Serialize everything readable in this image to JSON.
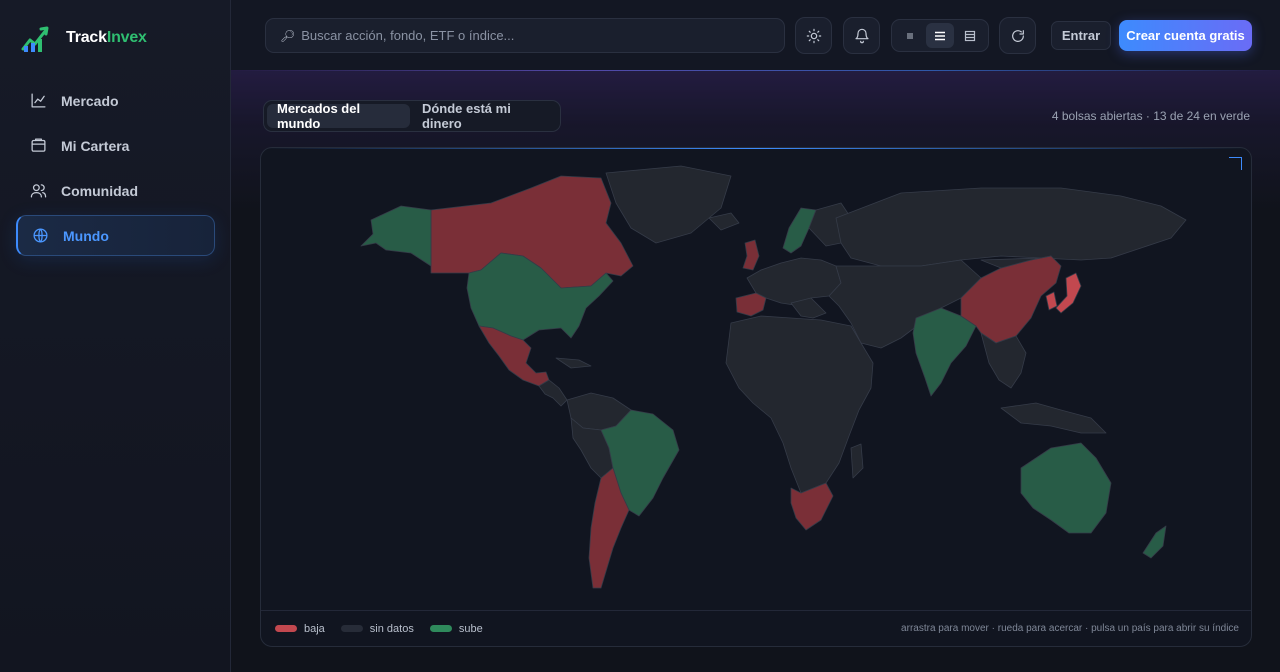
{
  "app": {
    "brand_first": "Track",
    "brand_second": "Invex"
  },
  "sidebar": {
    "items": [
      {
        "label": "Mercado",
        "icon": "chart-line-icon",
        "active": false
      },
      {
        "label": "Mi Cartera",
        "icon": "wallet-icon",
        "active": false
      },
      {
        "label": "Comunidad",
        "icon": "users-icon",
        "active": false
      },
      {
        "label": "Mundo",
        "icon": "globe-icon",
        "active": true
      }
    ]
  },
  "topbar": {
    "search_placeholder": "Buscar acción, fondo, ETF o índice...",
    "login_label": "Entrar",
    "signup_label": "Crear cuenta gratis",
    "density_options": [
      "compact",
      "normal",
      "comfortable"
    ],
    "density_selected": "normal"
  },
  "main": {
    "tabs": [
      {
        "label": "Mercados del mundo",
        "active": true
      },
      {
        "label": "Dónde está mi dinero",
        "active": false
      }
    ],
    "status": "4 bolsas abiertas · 13 de 24 en verde"
  },
  "map": {
    "legend": [
      {
        "label": "baja",
        "color": "#c2484f"
      },
      {
        "label": "sin datos",
        "color": "#272c38"
      },
      {
        "label": "sube",
        "color": "#2f8a5c"
      }
    ],
    "hint": "arrastra para mover · rueda para acercar · pulsa un país para abrir su índice",
    "colors": {
      "down": "#7a2f37",
      "nodata": "#23272f",
      "up": "#285c47",
      "border": "#353b48"
    }
  }
}
